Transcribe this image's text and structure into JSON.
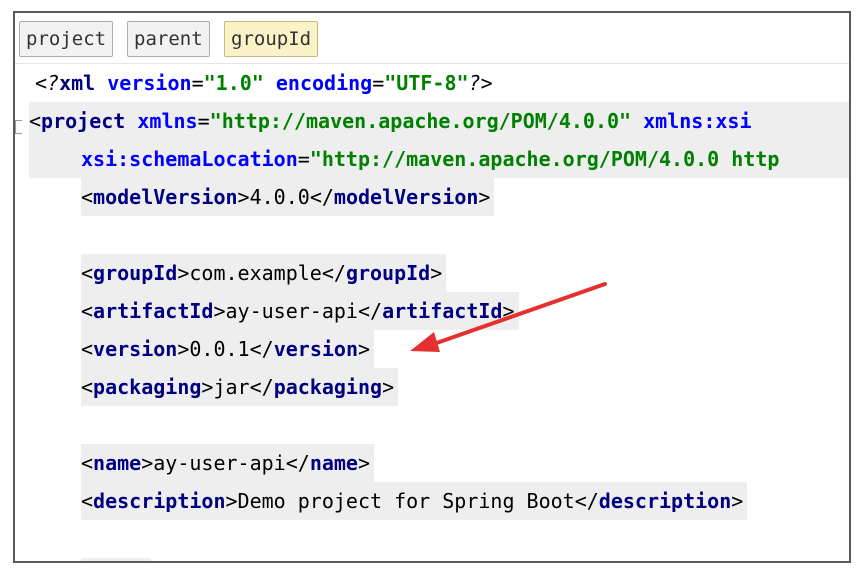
{
  "breadcrumbs": [
    "project",
    "parent",
    "groupId"
  ],
  "code": {
    "xml_decl": {
      "open": "<?",
      "name": "xml",
      "v_attr": "version",
      "v_val": "\"1.0\"",
      "e_attr": "encoding",
      "e_val": "\"UTF-8\"",
      "close": "?>"
    },
    "project_open": {
      "lt": "<",
      "tag": "project",
      "attr": "xmlns",
      "eq": "=",
      "val": "\"http://maven.apache.org/POM/4.0.0\"",
      "attr2": "xmlns:xsi"
    },
    "schema": {
      "attr": "xsi:schemaLocation",
      "eq": "=",
      "val": "\"http://maven.apache.org/POM/4.0.0 http"
    },
    "elements": [
      {
        "tag": "modelVersion",
        "text": "4.0.0"
      },
      {
        "tag": "groupId",
        "text": "com.example"
      },
      {
        "tag": "artifactId",
        "text": "ay-user-api"
      },
      {
        "tag": "version",
        "text": "0.0.1"
      },
      {
        "tag": "packaging",
        "text": "jar"
      },
      {
        "tag": "name",
        "text": "ay-user-api"
      },
      {
        "tag": "description",
        "text": "Demo project for Spring Boot"
      }
    ]
  },
  "colors": {
    "tag": "#000080",
    "attribute": "#0000ff",
    "string": "#008000",
    "arrow": "#e53030",
    "line_highlight": "#eeeeee",
    "active_crumb": "#fbf3c8"
  }
}
